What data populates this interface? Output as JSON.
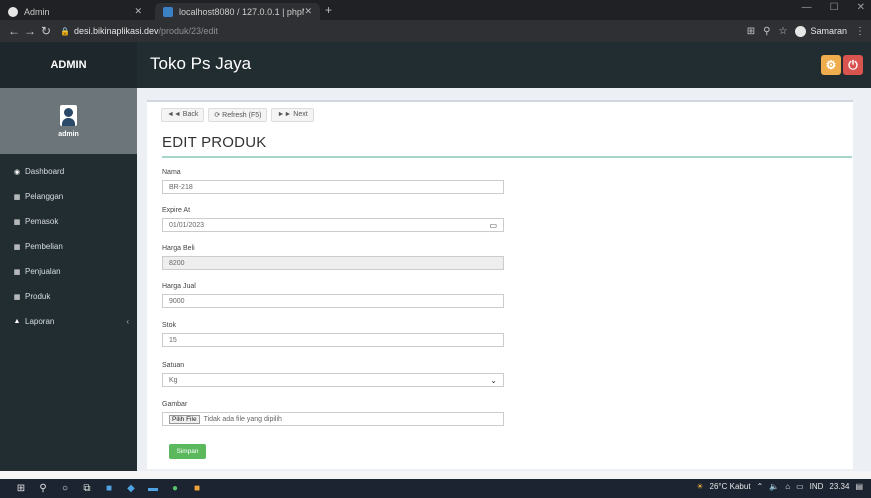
{
  "browser": {
    "tabs": [
      {
        "title": "Admin"
      },
      {
        "title": "localhost8080 / 127.0.0.1 | phpM"
      }
    ],
    "url_host": "desi.bikinaplikasi.dev",
    "url_path": "/produk/23/edit",
    "profile_name": "Samaran"
  },
  "header": {
    "brand": "ADMIN",
    "title": "Toko Ps Jaya"
  },
  "sidebar": {
    "user_name": "admin",
    "items": [
      {
        "label": "Dashboard"
      },
      {
        "label": "Pelanggan"
      },
      {
        "label": "Pemasok"
      },
      {
        "label": "Pembelian"
      },
      {
        "label": "Penjualan"
      },
      {
        "label": "Produk"
      },
      {
        "label": "Laporan"
      }
    ]
  },
  "toolbar": {
    "back": "◄◄ Back",
    "refresh": "⟳ Refresh (F5)",
    "next": "►► Next"
  },
  "page": {
    "title": "EDIT PRODUK"
  },
  "form": {
    "nama_label": "Nama",
    "nama_value": "BR-218",
    "expire_label": "Expire At",
    "expire_value": "01/01/2023",
    "harga_beli_label": "Harga Beli",
    "harga_beli_value": "8200",
    "harga_jual_label": "Harga Jual",
    "harga_jual_value": "9000",
    "stok_label": "Stok",
    "stok_value": "15",
    "satuan_label": "Satuan",
    "satuan_value": "Kg",
    "gambar_label": "Gambar",
    "file_button": "Pilih File",
    "file_status": "Tidak ada file yang dipilih",
    "save": "Simpan"
  },
  "taskbar": {
    "weather": "26°C Kabut",
    "lang": "IND",
    "time": "23.34"
  }
}
